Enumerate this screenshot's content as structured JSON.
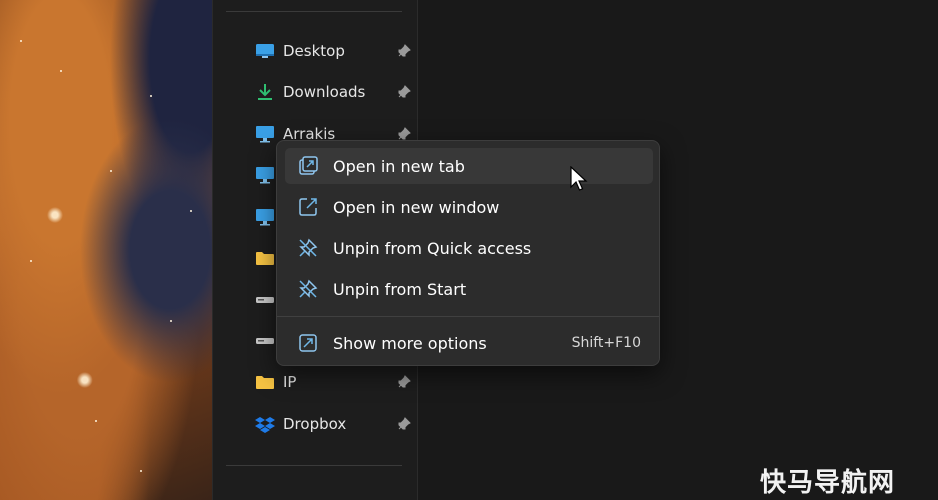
{
  "nav": {
    "items": [
      {
        "label": "Desktop",
        "icon": "desktop-icon",
        "pinned": true
      },
      {
        "label": "Downloads",
        "icon": "download-icon",
        "pinned": true
      },
      {
        "label": "Arrakis",
        "icon": "monitor-icon",
        "pinned": true
      },
      {
        "label": "",
        "icon": "monitor-icon",
        "pinned": false
      },
      {
        "label": "",
        "icon": "monitor-icon",
        "pinned": false
      },
      {
        "label": "",
        "icon": "folder-icon",
        "pinned": false
      },
      {
        "label": "",
        "icon": "drive-icon",
        "pinned": false
      },
      {
        "label": "",
        "icon": "drive-icon",
        "pinned": false
      },
      {
        "label": "IP",
        "icon": "folder-icon",
        "pinned": true
      },
      {
        "label": "Dropbox",
        "icon": "dropbox-icon",
        "pinned": true
      }
    ]
  },
  "context_menu": {
    "items": [
      {
        "label": "Open in new tab",
        "icon": "new-tab-icon"
      },
      {
        "label": "Open in new window",
        "icon": "new-window-icon"
      },
      {
        "label": "Unpin from Quick access",
        "icon": "unpin-icon"
      },
      {
        "label": "Unpin from Start",
        "icon": "unpin-icon"
      }
    ],
    "more": {
      "label": "Show more options",
      "shortcut": "Shift+F10",
      "icon": "more-options-icon"
    }
  },
  "colors": {
    "accent": "#6fb6e6",
    "menu_bg": "#2c2c2c",
    "hover_bg": "#383838",
    "folder": "#f6c343",
    "download": "#2fbf71"
  },
  "watermark": "快马导航网"
}
